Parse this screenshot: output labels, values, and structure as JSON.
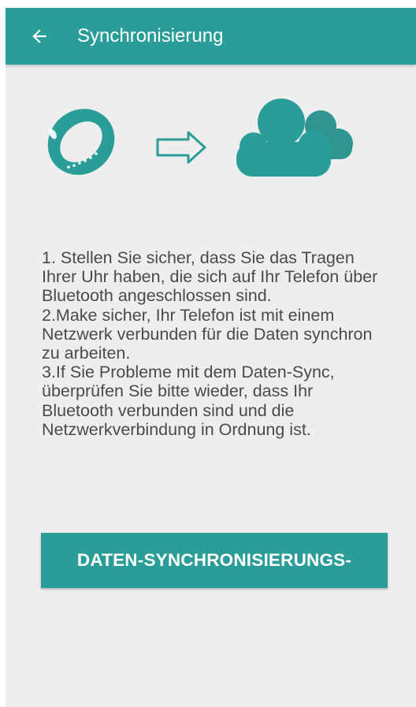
{
  "app_bar": {
    "title": "Synchronisierung",
    "back_icon": "arrow-left-icon"
  },
  "illustration": {
    "icons": [
      "fitness-band-icon",
      "arrow-right-icon",
      "cloud-icon"
    ]
  },
  "instructions": [
    "1. Stellen Sie sicher, dass Sie das Tragen Ihrer Uhr haben, die sich auf Ihr Telefon über Bluetooth angeschlossen sind.",
    "2.Make sicher, Ihr Telefon ist mit einem Netzwerk verbunden für die Daten synchron zu arbeiten.",
    "3.If Sie Probleme mit dem Daten-Sync, überprüfen Sie bitte wieder, dass Ihr Bluetooth verbunden sind und die Netzwerkverbindung in Ordnung ist."
  ],
  "sync_button": {
    "label": "DATEN-SYNCHRONISIERUNGS-"
  },
  "colors": {
    "primary": "#2a9d98",
    "background": "#eeeeee",
    "text": "#4a4a4a"
  }
}
